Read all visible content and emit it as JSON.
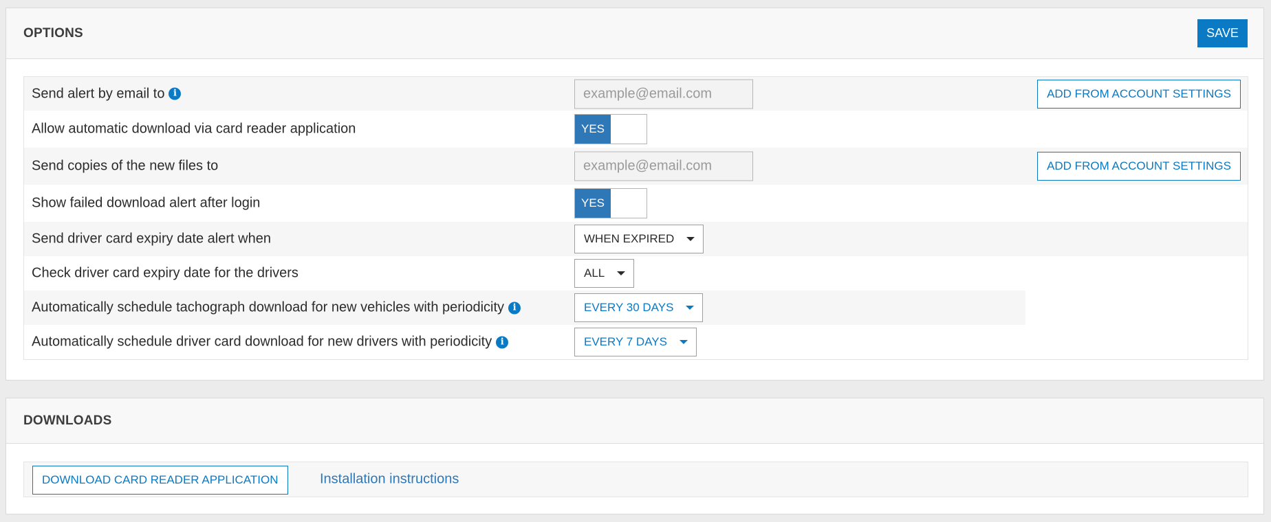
{
  "options": {
    "title": "OPTIONS",
    "save_label": "SAVE",
    "rows": [
      {
        "label": "Send alert by email to",
        "has_info": true,
        "control": "email",
        "placeholder": "example@email.com",
        "button_label": "ADD FROM ACCOUNT SETTINGS"
      },
      {
        "label": "Allow automatic download via card reader application",
        "control": "toggle",
        "value": "YES"
      },
      {
        "label": "Send copies of the new files to",
        "control": "email",
        "placeholder": "example@email.com",
        "button_label": "ADD FROM ACCOUNT SETTINGS"
      },
      {
        "label": "Show failed download alert after login",
        "control": "toggle",
        "value": "YES"
      },
      {
        "label": "Send driver card expiry date alert when",
        "control": "select",
        "value": "WHEN EXPIRED"
      },
      {
        "label": "Check driver card expiry date for the drivers",
        "control": "select",
        "value": "ALL"
      },
      {
        "label": "Automatically schedule tachograph download for new vehicles with periodicity",
        "has_info": true,
        "control": "select",
        "value": "EVERY 30 DAYS"
      },
      {
        "label": "Automatically schedule driver card download for new drivers with periodicity",
        "has_info": true,
        "control": "select",
        "value": "EVERY 7 DAYS"
      }
    ]
  },
  "downloads": {
    "title": "DOWNLOADS",
    "download_button_label": "DOWNLOAD CARD READER APPLICATION",
    "instructions_link": "Installation instructions"
  },
  "icons": {
    "info": "info-icon",
    "caret": "caret-down-icon"
  },
  "colors": {
    "accent": "#0b7ac4",
    "toggle_on": "#2f78b8",
    "panel_header_bg": "#f8f8f8",
    "row_shade": "#f6f6f6"
  }
}
